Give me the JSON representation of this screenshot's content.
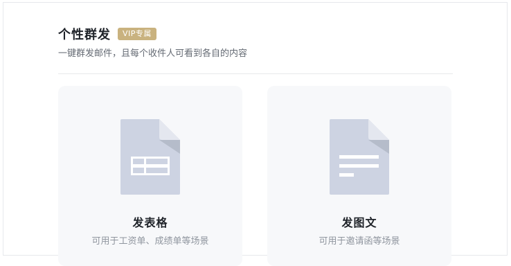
{
  "header": {
    "title": "个性群发",
    "badge": "VIP专属",
    "subtitle": "一键群发邮件，且每个收件人可看到各自的内容"
  },
  "options": [
    {
      "title": "发表格",
      "desc": "可用于工资单、成绩单等场景",
      "icon": "spreadsheet-doc-icon"
    },
    {
      "title": "发图文",
      "desc": "可用于邀请函等场景",
      "icon": "text-doc-icon"
    }
  ],
  "colors": {
    "badge_bg": "#c9b27f",
    "card_bg": "#f7f8fa",
    "icon_fill": "#cdd3e2"
  }
}
